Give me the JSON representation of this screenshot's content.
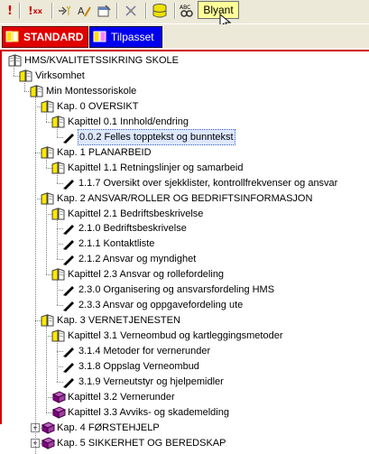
{
  "toolbar": {
    "icons": [
      "exclaim-icon",
      "exclaim-double-x-icon",
      "run-icon",
      "edit-text-icon",
      "properties-icon",
      "crossed-tool-icon",
      "database-icon",
      "spellcheck-icon"
    ],
    "pencil_label": "Blyant"
  },
  "tabs": [
    {
      "label": "STANDARD",
      "active": true,
      "color": "#e00000"
    },
    {
      "label": "Tilpasset",
      "active": false,
      "color": "#0000ee"
    }
  ],
  "tree": [
    {
      "level": 0,
      "type": "book",
      "label": "HMS/KVALITETSSIKRING SKOLE"
    },
    {
      "level": 1,
      "type": "book-open-yellow",
      "label": "Virksomhet"
    },
    {
      "level": 2,
      "type": "book-open-yellow",
      "label": "Min Montessoriskole"
    },
    {
      "level": 3,
      "type": "book-open-yellow",
      "label": "Kap. 0  OVERSIKT"
    },
    {
      "level": 4,
      "type": "book-open-yellow",
      "label": "Kapittel 0.1 Innhold/endring"
    },
    {
      "level": 5,
      "type": "pen",
      "label": "0.0.2 Felles topptekst og bunntekst",
      "selected": true
    },
    {
      "level": 3,
      "type": "book-open-yellow",
      "label": "Kap. 1   PLANARBEID"
    },
    {
      "level": 4,
      "type": "book-open-yellow",
      "label": "Kapittel 1.1 Retningslinjer og samarbeid"
    },
    {
      "level": 5,
      "type": "pen",
      "label": "1.1.7 Oversikt over sjekklister, kontrollfrekvenser og ansvar"
    },
    {
      "level": 3,
      "type": "book-open-yellow",
      "label": "Kap. 2  ANSVAR/ROLLER OG BEDRIFTSINFORMASJON"
    },
    {
      "level": 4,
      "type": "book-open-yellow",
      "label": "Kapittel 2.1 Bedriftsbeskrivelse"
    },
    {
      "level": 5,
      "type": "pen",
      "label": "2.1.0 Bedriftsbeskrivelse"
    },
    {
      "level": 5,
      "type": "pen",
      "label": "2.1.1 Kontaktliste"
    },
    {
      "level": 5,
      "type": "pen",
      "label": "2.1.2 Ansvar og myndighet"
    },
    {
      "level": 4,
      "type": "book-open-yellow",
      "label": "Kapittel 2.3 Ansvar og rollefordeling"
    },
    {
      "level": 5,
      "type": "pen",
      "label": "2.3.0 Organisering og ansvarsfordeling HMS"
    },
    {
      "level": 5,
      "type": "pen",
      "label": "2.3.3 Ansvar og oppgavefordeling ute"
    },
    {
      "level": 3,
      "type": "book-open-yellow",
      "label": "Kap. 3   VERNETJENESTEN"
    },
    {
      "level": 4,
      "type": "book-open-yellow",
      "label": "Kapittel 3.1 Verneombud og kartleggingsmetoder"
    },
    {
      "level": 5,
      "type": "pen",
      "label": "3.1.4 Metoder for vernerunder"
    },
    {
      "level": 5,
      "type": "pen",
      "label": "3.1.8 Oppslag Verneombud"
    },
    {
      "level": 5,
      "type": "pen",
      "label": "3.1.9 Verneutstyr og hjelpemidler"
    },
    {
      "level": 4,
      "type": "book-closed",
      "label": "Kapittel 3.2 Vernerunder"
    },
    {
      "level": 4,
      "type": "book-closed",
      "label": "Kapittel 3.3 Avviks- og skademelding"
    },
    {
      "level": 3,
      "type": "book-closed",
      "label": "Kap. 4   FØRSTEHJELP",
      "collapsed": true
    },
    {
      "level": 3,
      "type": "book-closed",
      "label": "Kap. 5  SIKKERHET OG BEREDSKAP",
      "collapsed": true
    }
  ]
}
